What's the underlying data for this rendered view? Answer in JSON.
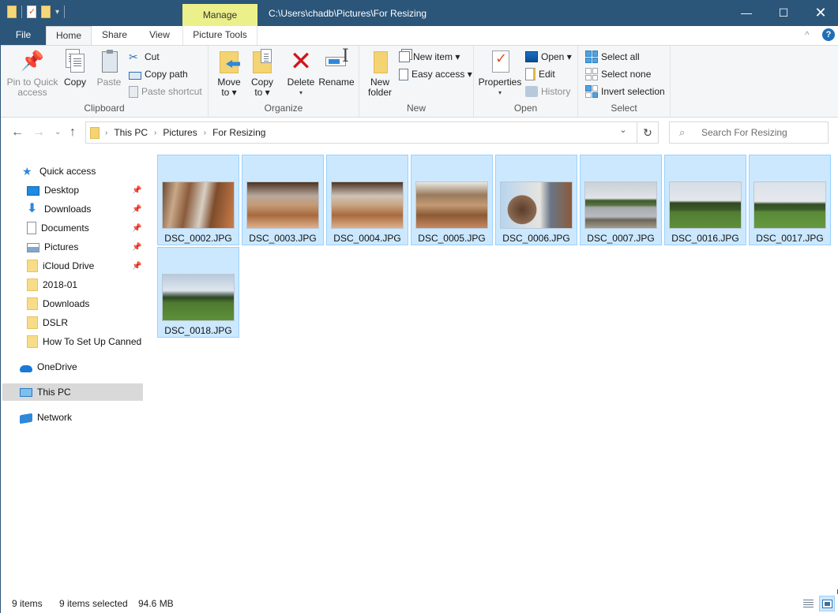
{
  "titlebar": {
    "path": "C:\\Users\\chadb\\Pictures\\For Resizing",
    "contextual_tab": "Manage",
    "controls": {
      "minimize": "—",
      "maximize": "☐",
      "close": "✕"
    }
  },
  "ribbon_tabs": {
    "file": "File",
    "home": "Home",
    "share": "Share",
    "view": "View",
    "picture_tools": "Picture Tools",
    "active": "Home"
  },
  "help_label": "?",
  "ribbon": {
    "clipboard": {
      "label": "Clipboard",
      "pin": "Pin to Quick access",
      "pin_l1": "Pin to Quick",
      "pin_l2": "access",
      "copy": "Copy",
      "paste": "Paste",
      "cut": "Cut",
      "copy_path": "Copy path",
      "paste_shortcut": "Paste shortcut"
    },
    "organize": {
      "label": "Organize",
      "move_l1": "Move",
      "move_l2": "to ▾",
      "copy_l1": "Copy",
      "copy_l2": "to ▾",
      "delete": "Delete",
      "delete_caret": "▾",
      "rename": "Rename"
    },
    "new": {
      "label": "New",
      "folder_l1": "New",
      "folder_l2": "folder",
      "new_item": "New item ▾",
      "easy_access": "Easy access ▾"
    },
    "open": {
      "label": "Open",
      "properties": "Properties",
      "properties_caret": "▾",
      "open": "Open ▾",
      "edit": "Edit",
      "history": "History"
    },
    "select": {
      "label": "Select",
      "select_all": "Select all",
      "select_none": "Select none",
      "invert": "Invert selection"
    }
  },
  "address": {
    "crumbs": [
      "This PC",
      "Pictures",
      "For Resizing"
    ],
    "search_placeholder": "Search For Resizing"
  },
  "nav": {
    "quick_access": "Quick access",
    "pinned": [
      {
        "label": "Desktop",
        "icon": "desktop-icon"
      },
      {
        "label": "Downloads",
        "icon": "downloads-icon"
      },
      {
        "label": "Documents",
        "icon": "documents-icon"
      },
      {
        "label": "Pictures",
        "icon": "pictures-icon"
      },
      {
        "label": "iCloud Drive",
        "icon": "folder-icon"
      }
    ],
    "recent": [
      "2018-01",
      "Downloads",
      "DSLR",
      "How To Set Up Canned Responses"
    ],
    "onedrive": "OneDrive",
    "this_pc": "This PC",
    "network": "Network",
    "selected": "This PC"
  },
  "files": [
    {
      "name": "DSC_0002.JPG",
      "selected": true,
      "subject": "dog indoors"
    },
    {
      "name": "DSC_0003.JPG",
      "selected": true,
      "subject": "dog on floor"
    },
    {
      "name": "DSC_0004.JPG",
      "selected": true,
      "subject": "dog on floor"
    },
    {
      "name": "DSC_0005.JPG",
      "selected": true,
      "subject": "dog on floor"
    },
    {
      "name": "DSC_0006.JPG",
      "selected": true,
      "subject": "dog close-up"
    },
    {
      "name": "DSC_0007.JPG",
      "selected": true,
      "subject": "river landscape"
    },
    {
      "name": "DSC_0016.JPG",
      "selected": true,
      "subject": "field landscape"
    },
    {
      "name": "DSC_0017.JPG",
      "selected": true,
      "subject": "field landscape"
    },
    {
      "name": "DSC_0018.JPG",
      "selected": true,
      "subject": "field landscape"
    }
  ],
  "status": {
    "item_count": "9 items",
    "selected_count": "9 items selected",
    "selected_size": "94.6 MB",
    "view": "Large icons"
  },
  "colors": {
    "titlebar": "#2b5579",
    "manage_tab": "#ecf08a",
    "selection_fill": "#cce8ff",
    "selection_border": "#99d1ff",
    "nav_selected": "#d9d9d9"
  }
}
